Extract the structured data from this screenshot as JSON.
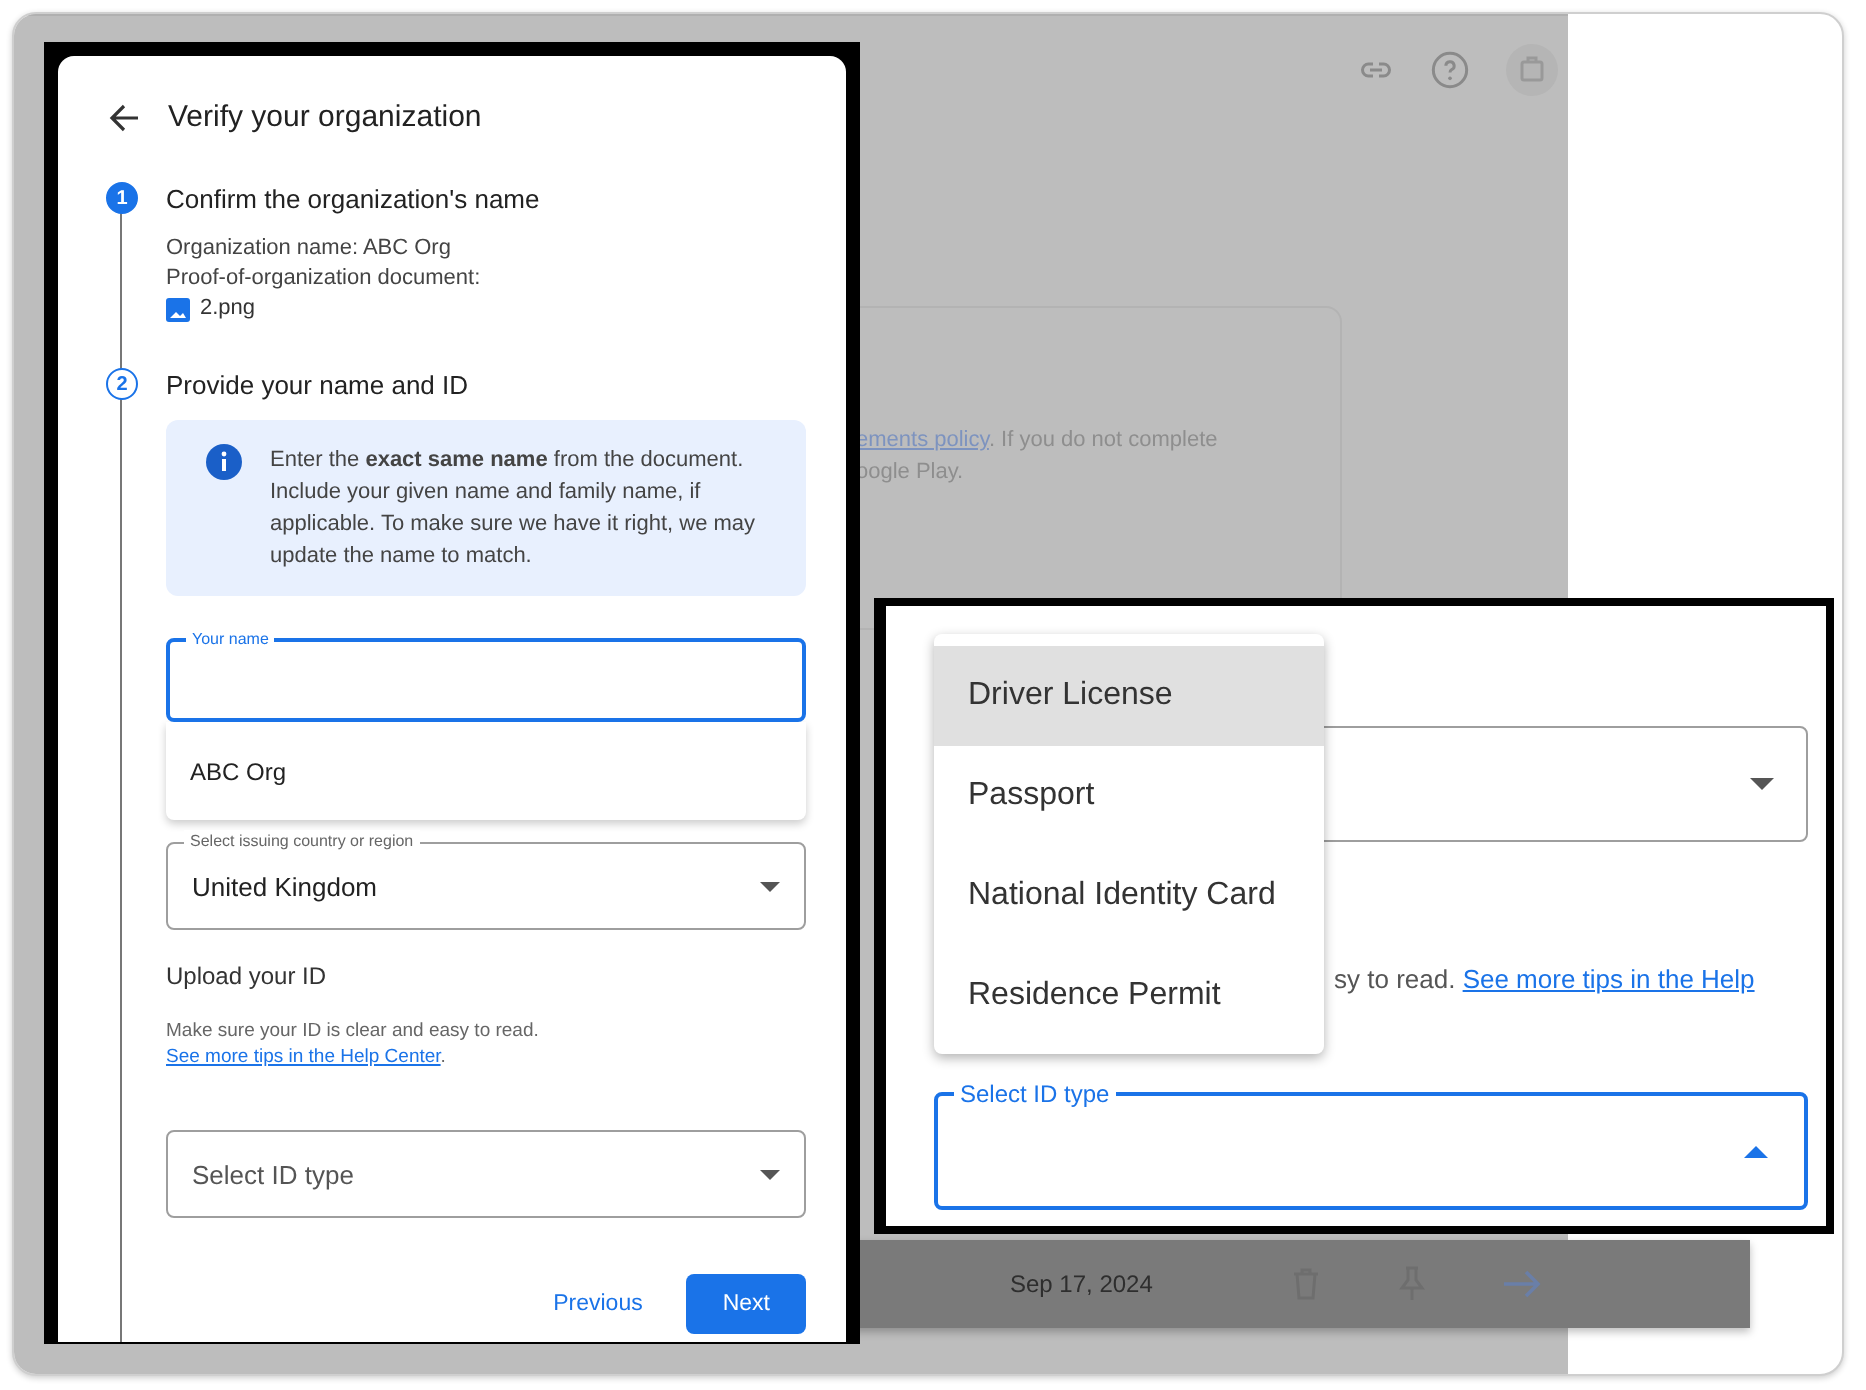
{
  "background": {
    "policy_link": "ements policy",
    "policy_text": ". If you do not complete",
    "policy_text_2": "oogle Play.",
    "date": "Sep 17, 2024"
  },
  "dialog": {
    "title": "Verify your organization",
    "steps": [
      {
        "number": "1",
        "title": "Confirm the organization's name",
        "completed": true,
        "lines": [
          "Organization name: ABC Org",
          "Proof-of-organization document:"
        ],
        "file": "2.png"
      },
      {
        "number": "2",
        "title": "Provide your name and ID",
        "completed": false
      }
    ],
    "info": "Enter the **exact same name** from the document. Include your given name and family name, if applicable. To make sure we have it right, we may update the name to match.",
    "name_field": {
      "label": "Your name",
      "focused": true
    },
    "suggestions": [
      "ABC Org"
    ],
    "country_field": {
      "label": "Select issuing country or region",
      "value": "United Kingdom"
    },
    "upload_title": "Upload your ID",
    "upload_help": "Make sure your ID is clear and easy to read.",
    "help_link": "See more tips in the Help Center",
    "help_end": ".",
    "id_field": {
      "placeholder": "Select ID type"
    },
    "buttons": [
      {
        "label": "Previous",
        "kind": "text"
      },
      {
        "label": "Next",
        "kind": "primary"
      }
    ]
  },
  "zoom_inset": {
    "help_fragment": "sy to read.",
    "help_link": "See more tips in the Help",
    "id_field": {
      "label": "Select ID type",
      "expanded": true
    },
    "options": [
      {
        "label": "Driver License",
        "selected": true
      },
      {
        "label": "Passport",
        "selected": false
      },
      {
        "label": "National Identity Card",
        "selected": false
      },
      {
        "label": "Residence Permit",
        "selected": false
      }
    ]
  }
}
